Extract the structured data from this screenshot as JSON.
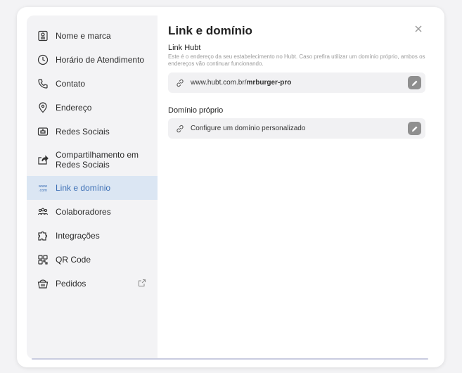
{
  "sidebar": {
    "items": [
      {
        "label": "Nome e marca",
        "icon": "id-card-icon"
      },
      {
        "label": "Horário de Atendimento",
        "icon": "clock-icon"
      },
      {
        "label": "Contato",
        "icon": "phone-icon"
      },
      {
        "label": "Endereço",
        "icon": "map-pin-icon"
      },
      {
        "label": "Redes Sociais",
        "icon": "social-icon"
      },
      {
        "label": "Compartilhamento em Redes Sociais",
        "icon": "share-icon"
      },
      {
        "label": "Link e domínio",
        "icon": "www-icon",
        "active": true
      },
      {
        "label": "Colaboradores",
        "icon": "users-icon"
      },
      {
        "label": "Integrações",
        "icon": "puzzle-icon"
      },
      {
        "label": "QR Code",
        "icon": "qr-code-icon"
      },
      {
        "label": "Pedidos",
        "icon": "basket-icon",
        "external": true
      }
    ]
  },
  "content": {
    "title": "Link e domínio",
    "link_section": {
      "title": "Link Hubt",
      "description": "Este é o endereço da seu estabelecimento no Hubt. Caso prefira utilizar um domínio próprio, ambos os endereços vão continuar funcionando.",
      "url_prefix": "www.hubt.com.br/",
      "url_slug": "mrburger-pro"
    },
    "domain_section": {
      "title": "Domínio próprio",
      "placeholder": "Configure um domínio personalizado"
    }
  },
  "colors": {
    "accent": "#3c6fb5",
    "active_bg": "#dbe6f3",
    "sidebar_bg": "#f3f3f5",
    "field_bg": "#f1f1f3",
    "edit_button": "#8f8f8f"
  }
}
